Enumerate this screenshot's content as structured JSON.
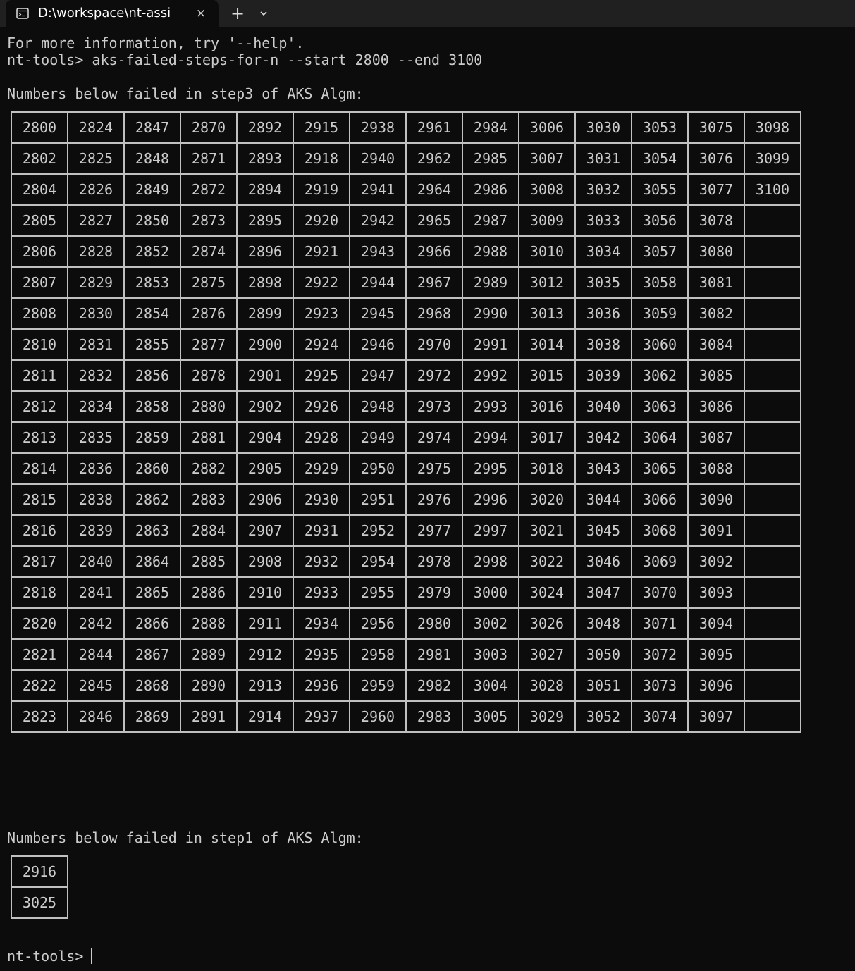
{
  "tab": {
    "title": "D:\\workspace\\nt-assi",
    "icon": "terminal-icon",
    "close_label": "×",
    "new_tab_label": "+",
    "dropdown_icon": "chevron-down-icon"
  },
  "terminal": {
    "line1": "For more information, try '--help'.",
    "line2": "nt-tools> aks-failed-steps-for-n --start 2800 --end 3100",
    "heading_step3": "Numbers below failed in step3 of AKS Algm:",
    "heading_step1": "Numbers below failed in step1 of AKS Algm:",
    "prompt": "nt-tools> "
  },
  "step3_columns": [
    [
      "2800",
      "2802",
      "2804",
      "2805",
      "2806",
      "2807",
      "2808",
      "2810",
      "2811",
      "2812",
      "2813",
      "2814",
      "2815",
      "2816",
      "2817",
      "2818",
      "2820",
      "2821",
      "2822",
      "2823"
    ],
    [
      "2824",
      "2825",
      "2826",
      "2827",
      "2828",
      "2829",
      "2830",
      "2831",
      "2832",
      "2834",
      "2835",
      "2836",
      "2838",
      "2839",
      "2840",
      "2841",
      "2842",
      "2844",
      "2845",
      "2846"
    ],
    [
      "2847",
      "2848",
      "2849",
      "2850",
      "2852",
      "2853",
      "2854",
      "2855",
      "2856",
      "2858",
      "2859",
      "2860",
      "2862",
      "2863",
      "2864",
      "2865",
      "2866",
      "2867",
      "2868",
      "2869"
    ],
    [
      "2870",
      "2871",
      "2872",
      "2873",
      "2874",
      "2875",
      "2876",
      "2877",
      "2878",
      "2880",
      "2881",
      "2882",
      "2883",
      "2884",
      "2885",
      "2886",
      "2888",
      "2889",
      "2890",
      "2891"
    ],
    [
      "2892",
      "2893",
      "2894",
      "2895",
      "2896",
      "2898",
      "2899",
      "2900",
      "2901",
      "2902",
      "2904",
      "2905",
      "2906",
      "2907",
      "2908",
      "2910",
      "2911",
      "2912",
      "2913",
      "2914"
    ],
    [
      "2915",
      "2918",
      "2919",
      "2920",
      "2921",
      "2922",
      "2923",
      "2924",
      "2925",
      "2926",
      "2928",
      "2929",
      "2930",
      "2931",
      "2932",
      "2933",
      "2934",
      "2935",
      "2936",
      "2937"
    ],
    [
      "2938",
      "2940",
      "2941",
      "2942",
      "2943",
      "2944",
      "2945",
      "2946",
      "2947",
      "2948",
      "2949",
      "2950",
      "2951",
      "2952",
      "2954",
      "2955",
      "2956",
      "2958",
      "2959",
      "2960"
    ],
    [
      "2961",
      "2962",
      "2964",
      "2965",
      "2966",
      "2967",
      "2968",
      "2970",
      "2972",
      "2973",
      "2974",
      "2975",
      "2976",
      "2977",
      "2978",
      "2979",
      "2980",
      "2981",
      "2982",
      "2983"
    ],
    [
      "2984",
      "2985",
      "2986",
      "2987",
      "2988",
      "2989",
      "2990",
      "2991",
      "2992",
      "2993",
      "2994",
      "2995",
      "2996",
      "2997",
      "2998",
      "3000",
      "3002",
      "3003",
      "3004",
      "3005"
    ],
    [
      "3006",
      "3007",
      "3008",
      "3009",
      "3010",
      "3012",
      "3013",
      "3014",
      "3015",
      "3016",
      "3017",
      "3018",
      "3020",
      "3021",
      "3022",
      "3024",
      "3026",
      "3027",
      "3028",
      "3029"
    ],
    [
      "3030",
      "3031",
      "3032",
      "3033",
      "3034",
      "3035",
      "3036",
      "3038",
      "3039",
      "3040",
      "3042",
      "3043",
      "3044",
      "3045",
      "3046",
      "3047",
      "3048",
      "3050",
      "3051",
      "3052"
    ],
    [
      "3053",
      "3054",
      "3055",
      "3056",
      "3057",
      "3058",
      "3059",
      "3060",
      "3062",
      "3063",
      "3064",
      "3065",
      "3066",
      "3068",
      "3069",
      "3070",
      "3071",
      "3072",
      "3073",
      "3074"
    ],
    [
      "3075",
      "3076",
      "3077",
      "3078",
      "3080",
      "3081",
      "3082",
      "3084",
      "3085",
      "3086",
      "3087",
      "3088",
      "3090",
      "3091",
      "3092",
      "3093",
      "3094",
      "3095",
      "3096",
      "3097"
    ],
    [
      "3098",
      "3099",
      "3100",
      "",
      "",
      "",
      "",
      "",
      "",
      "",
      "",
      "",
      "",
      "",
      "",
      "",
      "",
      "",
      "",
      ""
    ]
  ],
  "step1_values": [
    "2916",
    "3025"
  ]
}
